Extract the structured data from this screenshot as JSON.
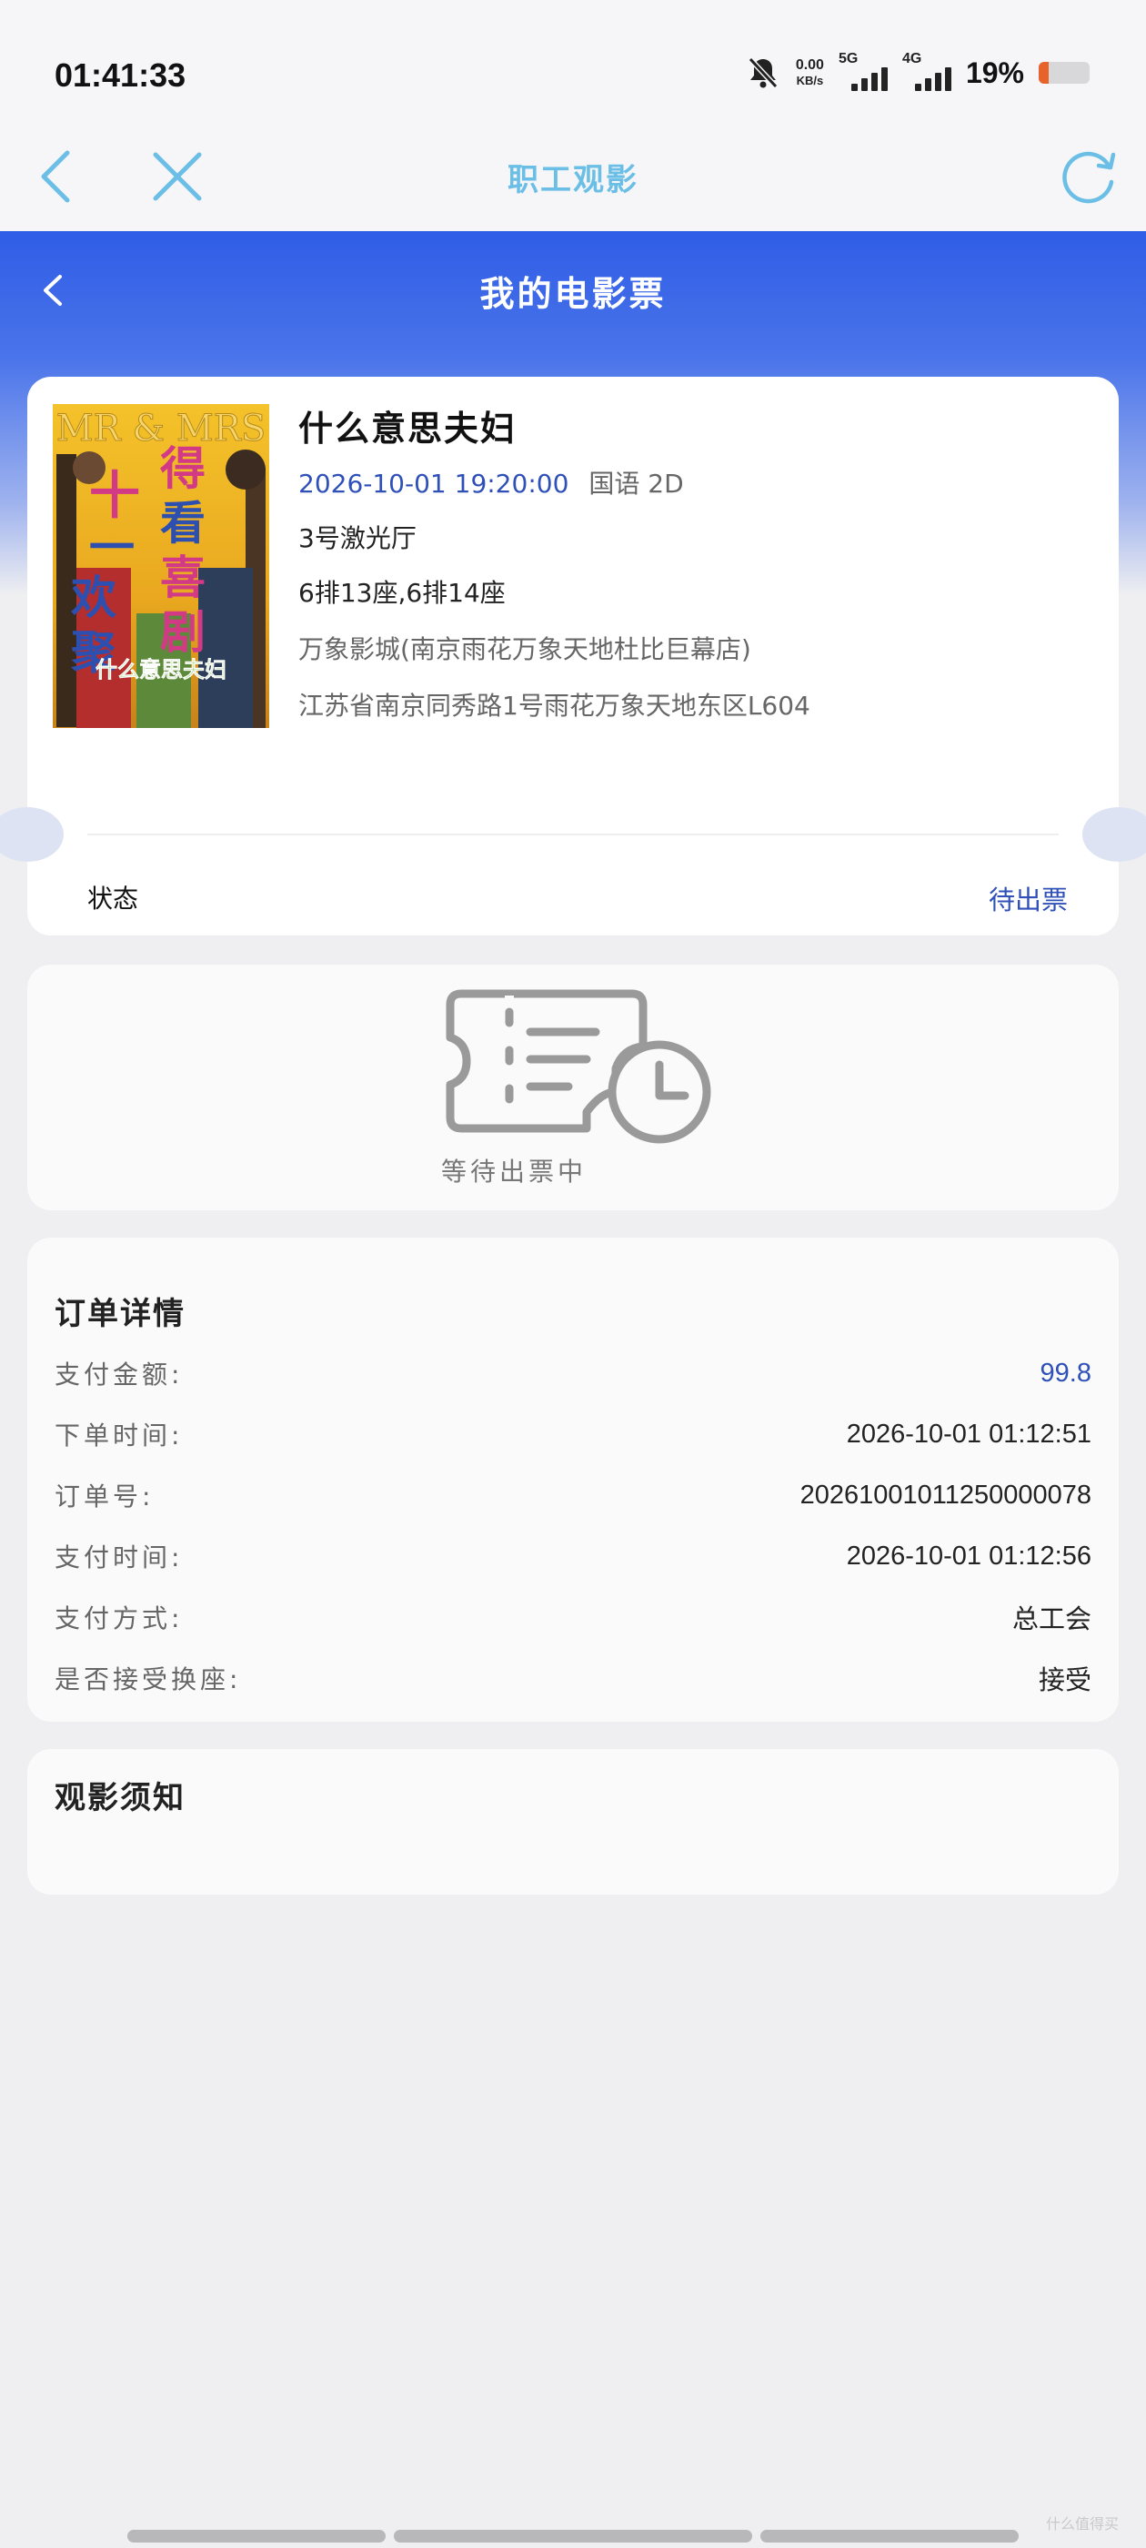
{
  "status_bar": {
    "time": "01:41:33",
    "net_speed_value": "0.00",
    "net_speed_unit": "KB/s",
    "network_1": "5G",
    "network_2": "4G",
    "battery_percent": "19%",
    "battery_level": 0.19,
    "battery_color": "#e8632a"
  },
  "nav": {
    "title": "职工观影",
    "back_icon": "chevron-left-icon",
    "close_icon": "close-icon",
    "refresh_icon": "refresh-icon"
  },
  "header": {
    "title": "我的电影票",
    "back_icon": "chevron-left-icon"
  },
  "ticket": {
    "movie_title": "什么意思夫妇",
    "showtime": "2026-10-01 19:20:00",
    "language_format": "国语 2D",
    "hall": "3号激光厅",
    "seats": "6排13座,6排14座",
    "cinema": "万象影城(南京雨花万象天地杜比巨幕店)",
    "address": "江苏省南京同秀路1号雨花万象天地东区L604",
    "status_label": "状态",
    "status_value": "待出票",
    "poster": {
      "top_text": "MR & MRS",
      "left_big": "十一欢聚",
      "right_big": "得看喜剧",
      "bottom": "什么意思夫妇"
    }
  },
  "waiting": {
    "icon": "ticket-clock-icon",
    "text": "等待出票中"
  },
  "order": {
    "title": "订单详情",
    "rows": [
      {
        "label": "支付金额:",
        "value": "99.8"
      },
      {
        "label": "下单时间:",
        "value": "2026-10-01 01:12:51"
      },
      {
        "label": "订单号:",
        "value": "20261001011250000078"
      },
      {
        "label": "支付时间:",
        "value": "2026-10-01 01:12:56"
      },
      {
        "label": "支付方式:",
        "value": "总工会"
      },
      {
        "label": "是否接受换座:",
        "value": "接受"
      }
    ]
  },
  "notice": {
    "title": "观影须知"
  },
  "colors": {
    "accent_blue": "#2e50b8",
    "header_blue": "#2f5de6",
    "nav_title": "#6bbfe6"
  },
  "watermark": "什么值得买"
}
